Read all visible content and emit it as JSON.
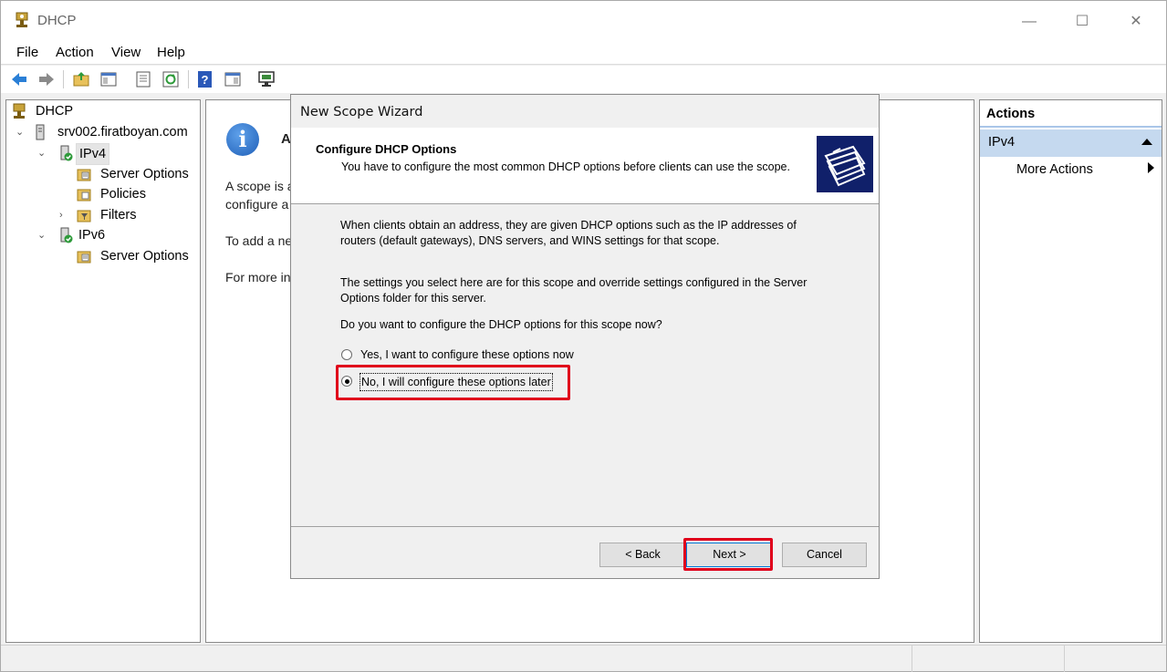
{
  "window": {
    "title": "DHCP",
    "controls": {
      "minimize": "—",
      "maximize": "☐",
      "close": "✕"
    }
  },
  "menu": [
    "File",
    "Action",
    "View",
    "Help"
  ],
  "toolbar": {
    "icons": [
      "back-arrow-icon",
      "forward-arrow-icon",
      "up-folder-icon",
      "show-hide-tree-icon",
      "properties-icon",
      "refresh-icon",
      "help-icon",
      "show-hide-action-pane-icon",
      "monitor-icon"
    ]
  },
  "tree": {
    "root": "DHCP",
    "server": "srv002.firatboyan.com",
    "ipv4": "IPv4",
    "ipv4_children": [
      "Server Options",
      "Policies",
      "Filters"
    ],
    "ipv6": "IPv6",
    "ipv6_children": [
      "Server Options"
    ]
  },
  "middle": {
    "heading_fragment": "A",
    "line1": "A scope is a",
    "line2": "configure a",
    "line3": "To add a ne",
    "line4": "For more in"
  },
  "actions": {
    "header": "Actions",
    "group": "IPv4",
    "more": "More Actions"
  },
  "wizard": {
    "title": "New Scope Wizard",
    "header_title": "Configure DHCP Options",
    "header_subtitle": "You have to configure the most common DHCP options before clients can use the scope.",
    "para1": "When clients obtain an address, they are given DHCP options such as the IP addresses of routers (default gateways), DNS servers, and WINS settings for that scope.",
    "para2": "The settings you select here are for this scope and override settings configured in the Server Options folder for this server.",
    "question": "Do you want to configure the DHCP options for this scope now?",
    "option_yes": "Yes, I want to configure these options now",
    "option_no": "No, I will configure these options later",
    "selected_option": "option_no",
    "buttons": {
      "back": "< Back",
      "next": "Next >",
      "cancel": "Cancel"
    }
  },
  "colors": {
    "highlight": "#e0001b",
    "actions_group_bg": "#c5d9ef",
    "wizard_graphic_bg": "#10206a"
  }
}
